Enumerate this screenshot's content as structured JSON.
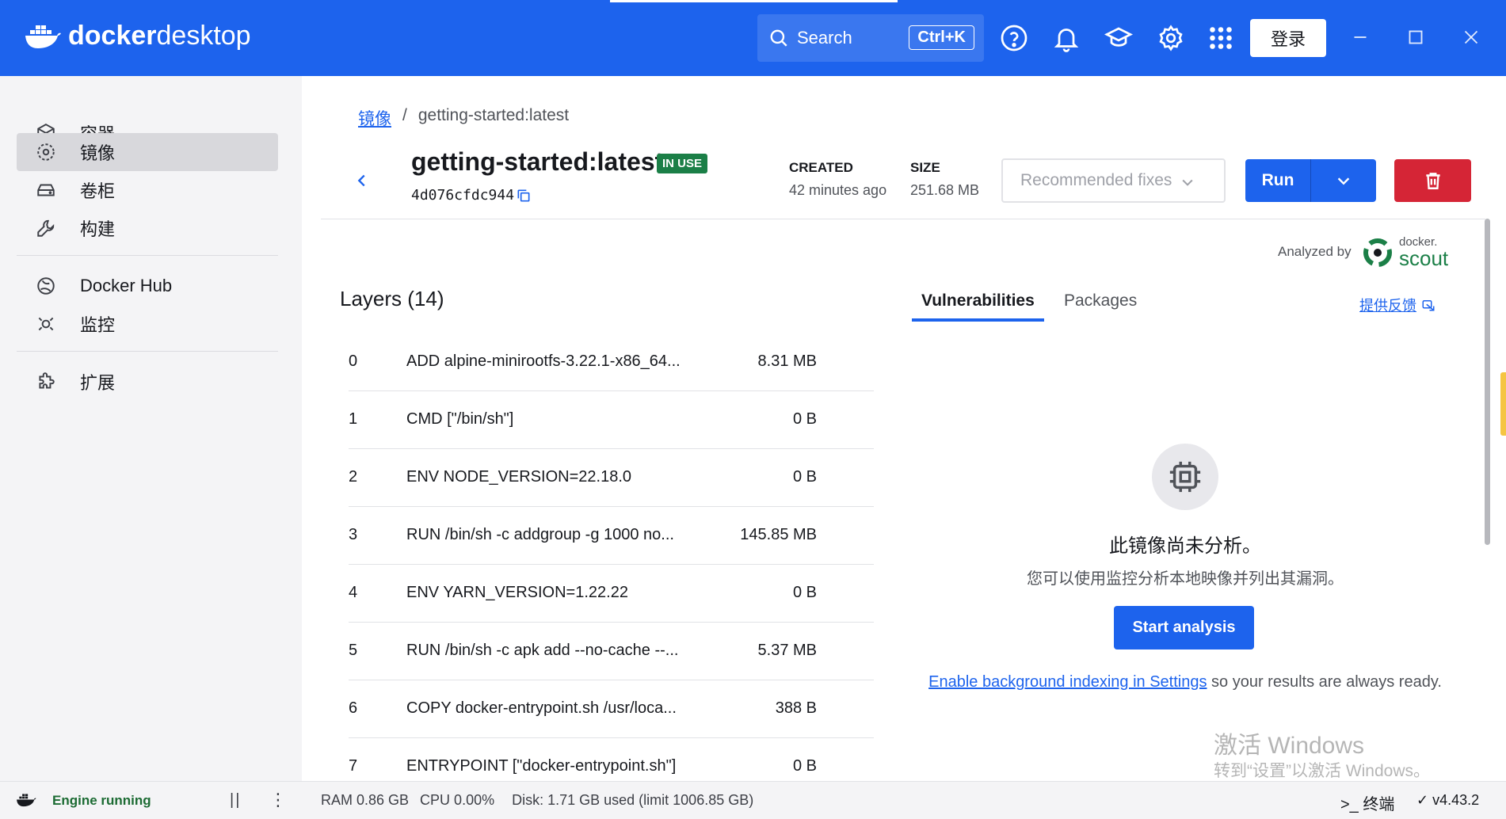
{
  "app": {
    "brand_left": "docker",
    "brand_right": "desktop",
    "search_label": "Search",
    "search_shortcut": "Ctrl+K",
    "login_label": "登录",
    "accent_color": "#1d63ed"
  },
  "sidebar": {
    "items": [
      {
        "label": "容器",
        "icon": "container-icon"
      },
      {
        "label": "镜像",
        "icon": "image-icon",
        "active": true
      },
      {
        "label": "卷柜",
        "icon": "volume-icon"
      },
      {
        "label": "构建",
        "icon": "build-icon"
      },
      {
        "label": "Docker Hub",
        "icon": "hub-icon"
      },
      {
        "label": "监控",
        "icon": "scout-icon"
      },
      {
        "label": "扩展",
        "icon": "extensions-icon"
      }
    ]
  },
  "breadcrumb": {
    "parent": "镜像",
    "separator": "/",
    "current": "getting-started:latest"
  },
  "image": {
    "name": "getting-started:latest",
    "badge": "IN USE",
    "id": "4d076cfdc944",
    "created_label": "CREATED",
    "created_value": "42 minutes ago",
    "size_label": "SIZE",
    "size_value": "251.68 MB"
  },
  "actions": {
    "recommended_fixes": "Recommended fixes",
    "run": "Run"
  },
  "layers": {
    "title": "Layers (14)",
    "rows": [
      {
        "index": "0",
        "command": "ADD alpine-minirootfs-3.22.1-x86_64...",
        "size": "8.31 MB"
      },
      {
        "index": "1",
        "command": "CMD [\"/bin/sh\"]",
        "size": "0 B"
      },
      {
        "index": "2",
        "command": "ENV NODE_VERSION=22.18.0",
        "size": "0 B"
      },
      {
        "index": "3",
        "command": "RUN /bin/sh -c addgroup -g 1000 no...",
        "size": "145.85 MB"
      },
      {
        "index": "4",
        "command": "ENV YARN_VERSION=1.22.22",
        "size": "0 B"
      },
      {
        "index": "5",
        "command": "RUN /bin/sh -c apk add --no-cache --...",
        "size": "5.37 MB"
      },
      {
        "index": "6",
        "command": "COPY docker-entrypoint.sh /usr/loca...",
        "size": "388 B"
      },
      {
        "index": "7",
        "command": "ENTRYPOINT [\"docker-entrypoint.sh\"]",
        "size": "0 B"
      }
    ]
  },
  "analysis": {
    "analyzed_by": "Analyzed by",
    "scout_brand_top": "docker.",
    "scout_brand_bottom": "scout",
    "tabs": [
      "Vulnerabilities",
      "Packages"
    ],
    "feedback": "提供反馈",
    "empty_title": "此镜像尚未分析。",
    "empty_subtitle": "您可以使用监控分析本地映像并列出其漏洞。",
    "start_button": "Start analysis",
    "indexing_link": "Enable background indexing in Settings",
    "indexing_text": " so your results are always ready."
  },
  "footer": {
    "engine_status": "Engine running",
    "ram": "RAM 0.86 GB",
    "cpu": "CPU 0.00%",
    "disk": "Disk: 1.71 GB used (limit 1006.85 GB)",
    "terminal": ">_ 终端",
    "version": "✓ v4.43.2"
  },
  "watermark": {
    "line1": "激活 Windows",
    "line2": "转到“设置”以激活 Windows。"
  }
}
